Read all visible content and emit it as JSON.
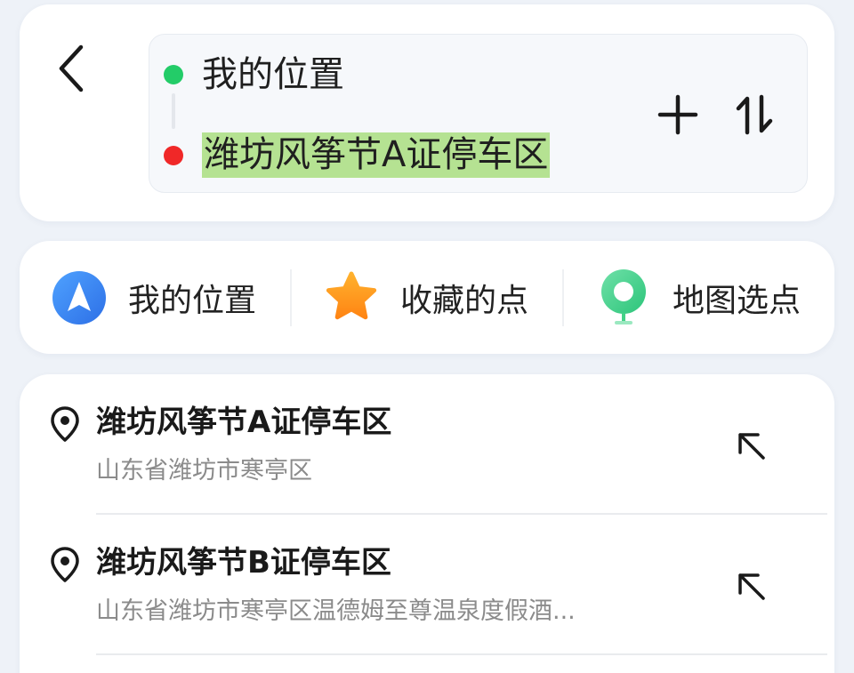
{
  "route": {
    "origin": "我的位置",
    "destination": "潍坊风筝节A证停车区"
  },
  "quick_actions": [
    {
      "label": "我的位置",
      "icon": "navigation-arrow-icon"
    },
    {
      "label": "收藏的点",
      "icon": "star-icon"
    },
    {
      "label": "地图选点",
      "icon": "map-pin-select-icon"
    }
  ],
  "results": [
    {
      "name": "潍坊风筝节A证停车区",
      "address": "山东省潍坊市寒亭区"
    },
    {
      "name": "潍坊风筝节B证停车区",
      "address": "山东省潍坊市寒亭区温德姆至尊温泉度假酒..."
    }
  ],
  "colors": {
    "origin_dot": "#23cc68",
    "destination_dot": "#f02828",
    "destination_highlight": "#b5e292",
    "location_icon_blue": "#3c86f3",
    "star_orange": "#ff9a1e",
    "map_pick_green": "#43d287"
  }
}
